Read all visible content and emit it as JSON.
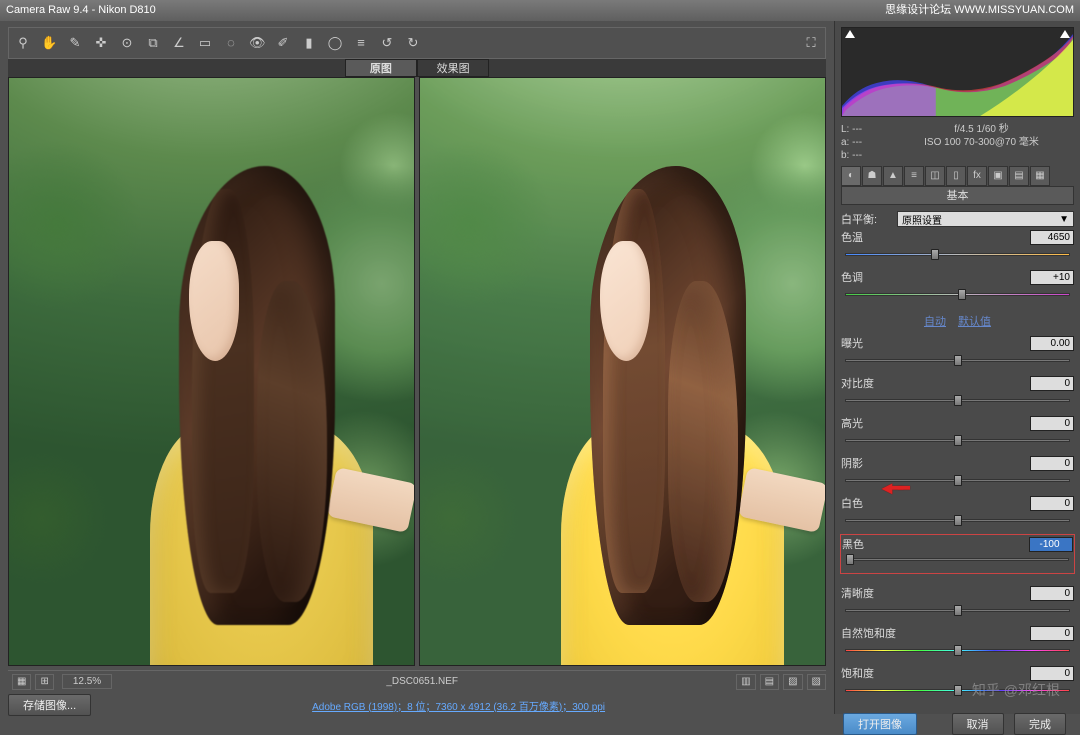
{
  "title": "Camera Raw 9.4  -  Nikon D810",
  "watermark_site": "思缘设计论坛  WWW.MISSYUAN.COM",
  "watermark_author": "知乎 @邓红根",
  "tabs": {
    "original": "原图",
    "effect": "效果图"
  },
  "zoom": "12.5%",
  "filename": "_DSC0651.NEF",
  "save_button": "存储图像...",
  "meta_link": "Adobe RGB (1998)；8 位；7360 x 4912 (36.2 百万像素)；300 ppi",
  "buttons": {
    "open": "打开图像",
    "cancel": "取消",
    "done": "完成"
  },
  "info_lab": {
    "L": "L:  ---",
    "a": "a:  ---",
    "b": "b:  ---"
  },
  "info_exif": {
    "line1": "f/4.5  1/60 秒",
    "line2": "ISO 100  70-300@70 毫米"
  },
  "panel_title": "基本",
  "wb": {
    "label": "白平衡:",
    "value": "原照设置"
  },
  "links": {
    "auto": "自动",
    "default": "默认值"
  },
  "sliders": {
    "temp": {
      "label": "色温",
      "value": "4650",
      "pos": 40
    },
    "tint": {
      "label": "色调",
      "value": "+10",
      "pos": 52
    },
    "exposure": {
      "label": "曝光",
      "value": "0.00",
      "pos": 50
    },
    "contrast": {
      "label": "对比度",
      "value": "0",
      "pos": 50
    },
    "highlights": {
      "label": "高光",
      "value": "0",
      "pos": 50
    },
    "shadows": {
      "label": "阴影",
      "value": "0",
      "pos": 50
    },
    "whites": {
      "label": "白色",
      "value": "0",
      "pos": 50
    },
    "blacks": {
      "label": "黑色",
      "value": "-100",
      "pos": 2,
      "highlight": true
    },
    "clarity": {
      "label": "清晰度",
      "value": "0",
      "pos": 50
    },
    "vibrance": {
      "label": "自然饱和度",
      "value": "0",
      "pos": 50
    },
    "saturation": {
      "label": "饱和度",
      "value": "0",
      "pos": 50
    }
  }
}
